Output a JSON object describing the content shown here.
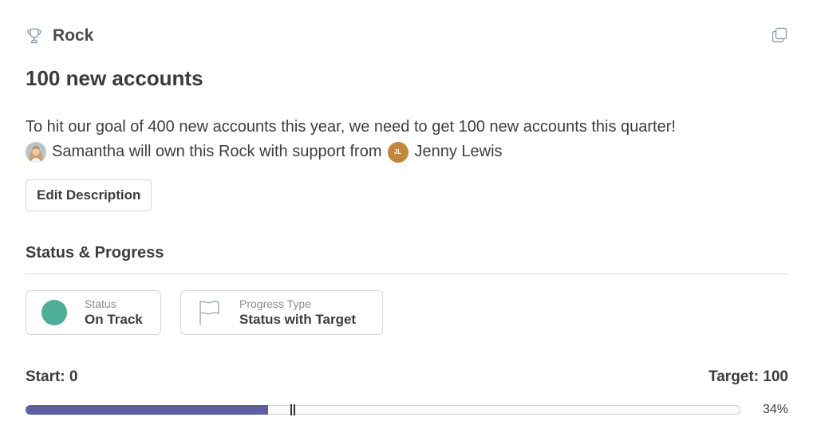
{
  "header": {
    "type_label": "Rock",
    "type_icon": "trophy-icon",
    "copy_icon": "copy-icon"
  },
  "title": "100 new accounts",
  "description": {
    "line1": "To hit our goal of 400 new accounts this year, we need to get 100 new accounts this quarter!",
    "line2_text": "Samantha will own this Rock with support from",
    "supporter_initials": "JL",
    "supporter_name": "Jenny Lewis"
  },
  "edit_button_label": "Edit Description",
  "section_title": "Status & Progress",
  "status_card": {
    "label": "Status",
    "value": "On Track",
    "color": "#4fae97"
  },
  "progress_type_card": {
    "label": "Progress Type",
    "value": "Status with Target",
    "icon": "flag-icon"
  },
  "progress": {
    "start_label": "Start: 0",
    "target_label": "Target: 100",
    "percent_label": "34%",
    "fraction": 0.34,
    "fill_color": "#5f5ea3"
  }
}
